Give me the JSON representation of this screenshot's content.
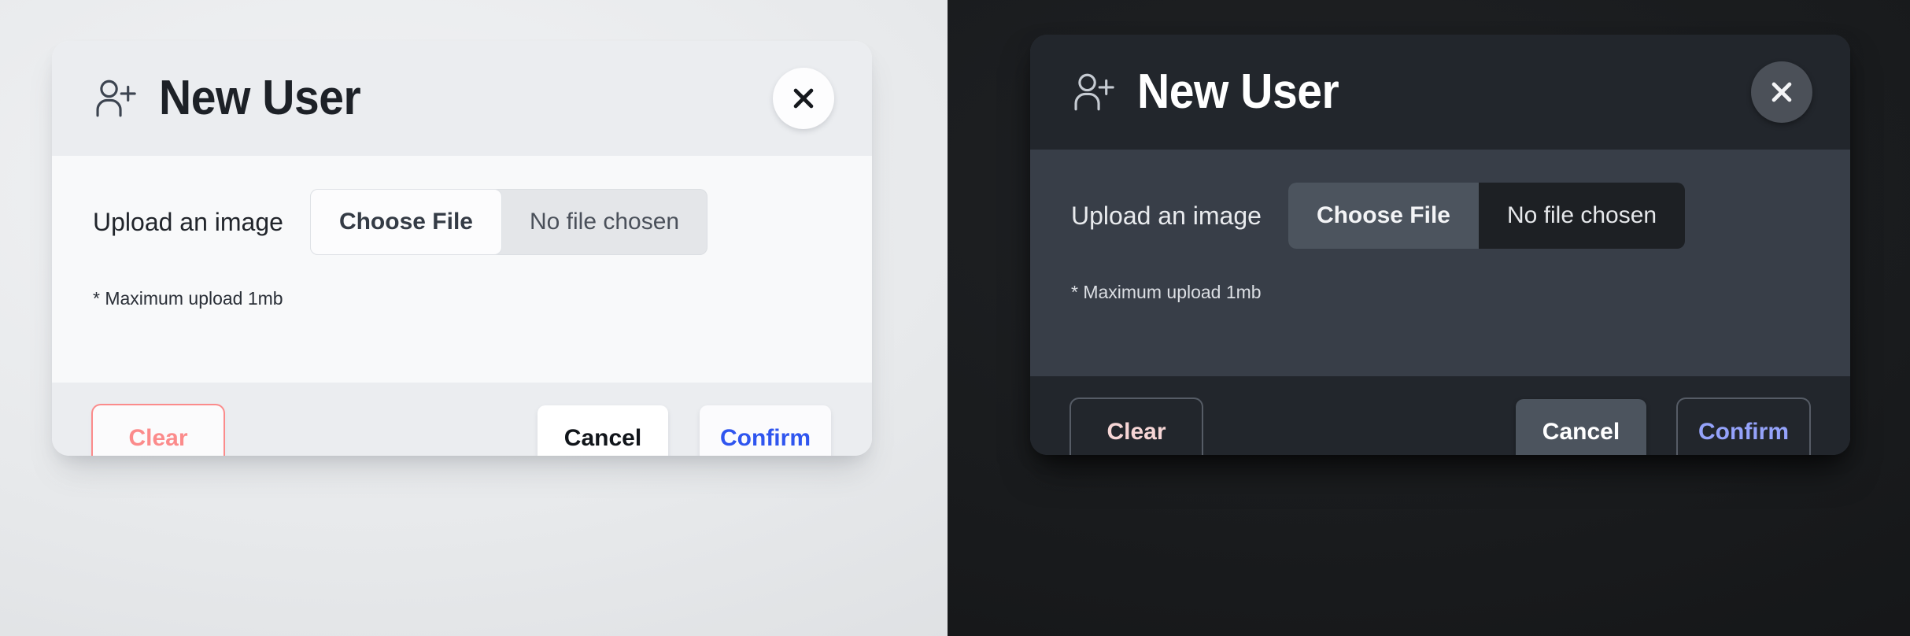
{
  "colors": {
    "light_bg": "#e7e9eb",
    "dark_bg": "#191b1d",
    "light_panel_header": "#ebedf0",
    "light_panel_body": "#f8f9fa",
    "dark_panel_header": "#22262c",
    "dark_panel_body": "#383e48",
    "clear_accent_light": "#fb8b8b",
    "clear_accent_dark": "#f6d6d6",
    "confirm_accent_light": "#2f55ef",
    "confirm_accent_dark": "#95a3fb",
    "cancel_text_light": "#11151a",
    "cancel_text_dark": "#ffffff"
  },
  "light": {
    "header": {
      "icon": "user-plus-icon",
      "title": "New User",
      "close_icon": "close-icon"
    },
    "body": {
      "upload_label": "Upload an image",
      "choose_file_label": "Choose File",
      "file_name": "No file chosen",
      "hint": "* Maximum upload 1mb"
    },
    "footer": {
      "clear_label": "Clear",
      "cancel_label": "Cancel",
      "confirm_label": "Confirm"
    }
  },
  "dark": {
    "header": {
      "icon": "user-plus-icon",
      "title": "New User",
      "close_icon": "close-icon"
    },
    "body": {
      "upload_label": "Upload an image",
      "choose_file_label": "Choose File",
      "file_name": "No file chosen",
      "hint": "* Maximum upload 1mb"
    },
    "footer": {
      "clear_label": "Clear",
      "cancel_label": "Cancel",
      "confirm_label": "Confirm"
    }
  }
}
